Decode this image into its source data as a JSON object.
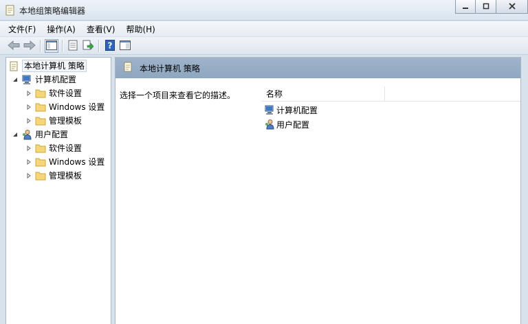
{
  "window": {
    "title": "本地组策略编辑器"
  },
  "menu": [
    {
      "label": "文件(F)"
    },
    {
      "label": "操作(A)"
    },
    {
      "label": "查看(V)"
    },
    {
      "label": "帮助(H)"
    }
  ],
  "toolbar": {
    "icons": [
      "back-arrow-icon",
      "forward-arrow-icon",
      "show-hide-tree-icon",
      "properties-icon",
      "export-list-icon",
      "help-icon",
      "show-hide-action-pane-icon"
    ]
  },
  "tree": {
    "root": {
      "label": "本地计算机 策略"
    },
    "computer": {
      "label": "计算机配置",
      "children": [
        {
          "label": "软件设置"
        },
        {
          "label": "Windows 设置"
        },
        {
          "label": "管理模板"
        }
      ]
    },
    "user": {
      "label": "用户配置",
      "children": [
        {
          "label": "软件设置"
        },
        {
          "label": "Windows 设置"
        },
        {
          "label": "管理模板"
        }
      ]
    }
  },
  "details": {
    "header_title": "本地计算机 策略",
    "description_hint": "选择一个项目来查看它的描述。",
    "column_name": "名称",
    "items": [
      {
        "label": "计算机配置",
        "icon": "computer-config-icon"
      },
      {
        "label": "用户配置",
        "icon": "user-config-icon"
      }
    ]
  },
  "colors": {
    "header_bg": "#9fb4ca",
    "folder": "#f5d77a",
    "titlebar": "#dde7f1"
  }
}
